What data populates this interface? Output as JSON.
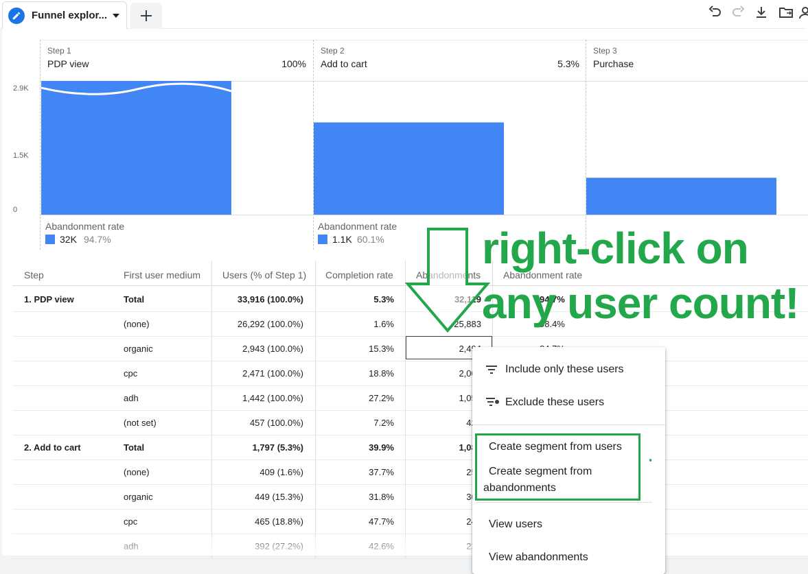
{
  "tab": {
    "title": "Funnel explor..."
  },
  "toolbar": {
    "icons": [
      "undo-icon",
      "redo-icon",
      "download-icon",
      "move-folder-icon",
      "person-icon"
    ]
  },
  "chart_data": {
    "type": "bar",
    "categories": [
      "PDP view",
      "Add to cart",
      "Purchase"
    ],
    "step_numbers": [
      "Step 1",
      "Step 2",
      "Step 3"
    ],
    "completion_percent": [
      "100%",
      "5.3%",
      ""
    ],
    "values": [
      2900,
      2000,
      800
    ],
    "yticks": [
      "2.9K",
      "1.5K",
      "0"
    ],
    "ylim": [
      0,
      2900
    ],
    "abandonment_label": "Abandonment rate",
    "abandonment": [
      {
        "count": "32K",
        "rate": "94.7%"
      },
      {
        "count": "1.1K",
        "rate": "60.1%"
      }
    ],
    "bar_color": "#4285f4"
  },
  "table": {
    "headers": [
      "Step",
      "First user medium",
      "Users (% of Step 1)",
      "Completion rate",
      "Abandonments",
      "Abandonment rate"
    ],
    "rows": [
      {
        "step": "1. PDP view",
        "medium": "Total",
        "users": "33,916 (100.0%)",
        "completion": "5.3%",
        "abandon": "32,119",
        "abandon_rate": "94.7%",
        "bold": true
      },
      {
        "step": "",
        "medium": "(none)",
        "users": "26,292 (100.0%)",
        "completion": "1.6%",
        "abandon": "25,883",
        "abandon_rate": "98.4%"
      },
      {
        "step": "",
        "medium": "organic",
        "users": "2,943 (100.0%)",
        "completion": "15.3%",
        "abandon": "2,494",
        "abandon_rate": "84.7%"
      },
      {
        "step": "",
        "medium": "cpc",
        "users": "2,471 (100.0%)",
        "completion": "18.8%",
        "abandon": "2,006",
        "abandon_rate": ""
      },
      {
        "step": "",
        "medium": "adh",
        "users": "1,442 (100.0%)",
        "completion": "27.2%",
        "abandon": "1,050",
        "abandon_rate": ""
      },
      {
        "step": "",
        "medium": "(not set)",
        "users": "457 (100.0%)",
        "completion": "7.2%",
        "abandon": "424",
        "abandon_rate": ""
      },
      {
        "step": "2. Add to cart",
        "medium": "Total",
        "users": "1,797 (5.3%)",
        "completion": "39.9%",
        "abandon": "1,080",
        "abandon_rate": "",
        "bold": true
      },
      {
        "step": "",
        "medium": "(none)",
        "users": "409 (1.6%)",
        "completion": "37.7%",
        "abandon": "255",
        "abandon_rate": ""
      },
      {
        "step": "",
        "medium": "organic",
        "users": "449 (15.3%)",
        "completion": "31.8%",
        "abandon": "306",
        "abandon_rate": ""
      },
      {
        "step": "",
        "medium": "cpc",
        "users": "465 (18.8%)",
        "completion": "47.7%",
        "abandon": "243",
        "abandon_rate": ""
      },
      {
        "step": "",
        "medium": "adh",
        "users": "392 (27.2%)",
        "completion": "42.6%",
        "abandon": "225",
        "abandon_rate": ""
      }
    ]
  },
  "annotation": {
    "line1": "right-click on",
    "line2": "any user count!",
    "color": "#22a84a"
  },
  "context_menu": {
    "include": "Include only these users",
    "exclude": "Exclude these users",
    "segment_users": "Create segment from users",
    "segment_abandon_1": "Create segment from",
    "segment_abandon_2": "abandonments",
    "view_users": "View users",
    "view_abandonments": "View abandonments"
  }
}
